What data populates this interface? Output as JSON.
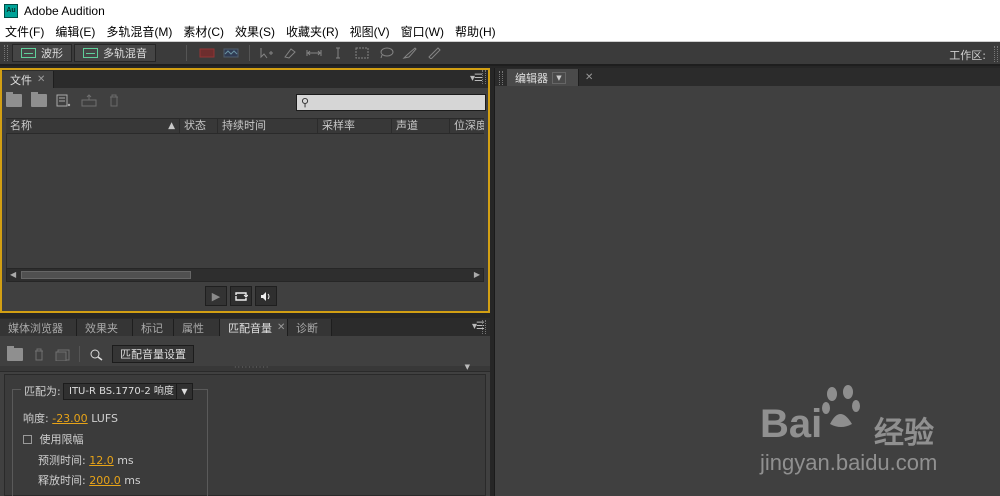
{
  "app": {
    "title": "Adobe Audition",
    "logo": "Au"
  },
  "menu": [
    "文件(F)",
    "编辑(E)",
    "多轨混音(M)",
    "素材(C)",
    "效果(S)",
    "收藏夹(R)",
    "视图(V)",
    "窗口(W)",
    "帮助(H)"
  ],
  "toolbar": {
    "waveform_label": "波形",
    "multitrack_label": "多轨混音",
    "workspace_label": "工作区:"
  },
  "files_panel": {
    "tab_label": "文件",
    "columns": [
      "名称",
      "状态",
      "持续时间",
      "采样率",
      "声道",
      "位深度"
    ]
  },
  "bottom_tabs": [
    {
      "label": "媒体浏览器",
      "active": false
    },
    {
      "label": "效果夹",
      "active": false
    },
    {
      "label": "标记",
      "active": false
    },
    {
      "label": "属性",
      "active": false
    },
    {
      "label": "匹配音量",
      "active": true
    },
    {
      "label": "诊断",
      "active": false
    }
  ],
  "match_volume": {
    "settings_button": "匹配音量设置",
    "match_to_label": "匹配为:",
    "match_to_value": "ITU-R BS.1770-2 响度",
    "loudness_label": "响度:",
    "loudness_value": "-23.00",
    "loudness_unit": "LUFS",
    "limiter_label": "使用限幅",
    "limiter_checked": false,
    "lookahead_label": "预测时间:",
    "lookahead_value": "12.0",
    "lookahead_unit": "ms",
    "release_label": "释放时间:",
    "release_value": "200.0",
    "release_unit": "ms"
  },
  "editor_panel": {
    "tab_label": "编辑器"
  },
  "colors": {
    "accent_orange": "#e7a318",
    "panel_border_active": "#d29f13",
    "waveform_green": "#5fcf9a"
  },
  "watermark": {
    "brand": "Bai",
    "brand2": "经验",
    "url": "jingyan.baidu.com"
  }
}
